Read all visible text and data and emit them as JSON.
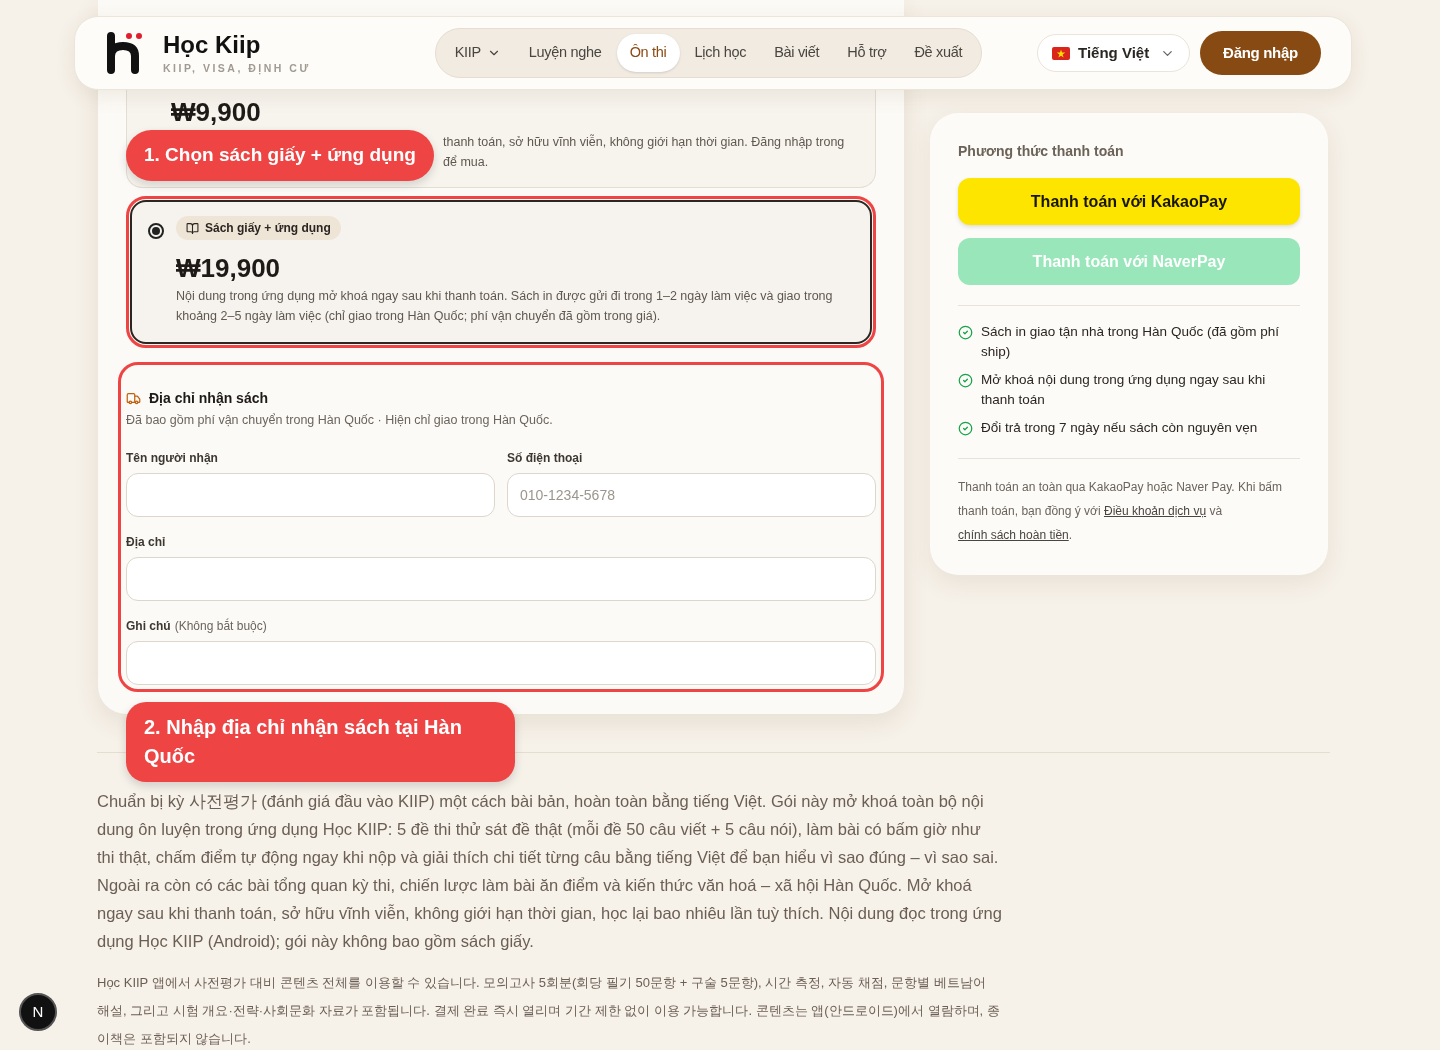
{
  "header": {
    "brand": "Học Kiip",
    "tagline": "KIIP, VISA, ĐỊNH CƯ",
    "nav": [
      {
        "label": "KIIP",
        "selected": false,
        "dropdown": true
      },
      {
        "label": "Luyện nghe",
        "selected": false,
        "dropdown": false
      },
      {
        "label": "Ôn thi",
        "selected": true,
        "dropdown": false
      },
      {
        "label": "Lịch học",
        "selected": false,
        "dropdown": false
      },
      {
        "label": "Bài viết",
        "selected": false,
        "dropdown": false
      },
      {
        "label": "Hỗ trợ",
        "selected": false,
        "dropdown": false
      },
      {
        "label": "Đề xuất",
        "selected": false,
        "dropdown": false
      }
    ],
    "language": "Tiếng Việt",
    "login": "Đăng nhập"
  },
  "options": [
    {
      "selected": false,
      "price": "₩9,900",
      "description": [
        "thanh toán, sở hữu vĩnh viễn, không giới hạn thời gian. Đăng nhập trong",
        "để mua."
      ]
    },
    {
      "selected": true,
      "badge": "Sách giấy + ứng dụng",
      "price": "₩19,900",
      "description": [
        "Nội dung trong ứng dụng mở khoá ngay sau khi thanh toán. Sách in được gửi đi trong 1–2 ngày làm việc và giao trong",
        "khoảng 2–5 ngày làm việc (chỉ giao trong Hàn Quốc; phí vận chuyển đã gồm trong giá)."
      ]
    }
  ],
  "address": {
    "title": "Địa chỉ nhận sách",
    "subtitle": "Đã bao gồm phí vận chuyển trong Hàn Quốc · Hiện chỉ giao trong Hàn Quốc.",
    "field_rows": [
      [
        {
          "label": "Tên người nhận"
        },
        {
          "label": "Số điện thoại",
          "placeholder": "010-1234-5678"
        }
      ],
      [
        {
          "label": "Địa chỉ"
        }
      ],
      [
        {
          "label": "Ghi chú",
          "hint": "(Không bắt buộc)"
        }
      ]
    ]
  },
  "callouts": [
    "1. Chọn sách giấy + ứng dụng",
    "2. Nhập địa chỉ nhận sách tại Hàn Quốc"
  ],
  "payment": {
    "title": "Phương thức thanh toán",
    "buttons": [
      {
        "kind": "kakao",
        "label": "Thanh toán với KakaoPay"
      },
      {
        "kind": "naver",
        "label": "Thanh toán với NaverPay"
      }
    ],
    "features": [
      "Sách in giao tận nhà trong Hàn Quốc (đã gồm phí ship)",
      "Mở khoá nội dung trong ứng dụng ngay sau khi thanh toán",
      "Đổi trả trong 7 ngày nếu sách còn nguyên vẹn"
    ],
    "note": {
      "text": "Thanh toán an toàn qua KakaoPay hoặc Naver Pay. Khi bấm thanh toán, bạn đồng ý với",
      "link1": "Điều khoản dịch vụ",
      "joiner": "và",
      "link2": "chính sách hoàn tiền",
      "end": "."
    }
  },
  "description": "Chuẩn bị kỳ 사전평가 (đánh giá đầu vào KIIP) một cách bài bản, hoàn toàn bằng tiếng Việt. Gói này mở khoá toàn bộ nội dung ôn luyện trong ứng dụng Học KIIP: 5 đề thi thử sát đề thật (mỗi đề 50 câu viết + 5 câu nói), làm bài có bấm giờ như thi thật, chấm điểm tự động ngay khi nộp và giải thích chi tiết từng câu bằng tiếng Việt để bạn hiểu vì sao đúng – vì sao sai. Ngoài ra còn có các bài tổng quan kỳ thi, chiến lược làm bài ăn điểm và kiến thức văn hoá – xã hội Hàn Quốc. Mở khoá ngay sau khi thanh toán, sở hữu vĩnh viễn, không giới hạn thời gian, học lại bao nhiêu lần tuỳ thích. Nội dung đọc trong ứng dụng Học KIIP (Android); gói này không bao gồm sách giấy.",
  "description_ko": "Học KIIP 앱에서 사전평가 대비 콘텐츠 전체를 이용할 수 있습니다. 모의고사 5회분(회당 필기 50문항 + 구술 5문항), 시간 측정, 자동 채점, 문항별 베트남어 해설, 그리고 시험 개요·전략·사회문화 자료가 포함됩니다. 결제 완료 즉시 열리며 기간 제한 없이 이용 가능합니다. 콘텐츠는 앱(안드로이드)에서 열람하며, 종이책은 포함되지 않습니다.",
  "dev_badge": "N"
}
